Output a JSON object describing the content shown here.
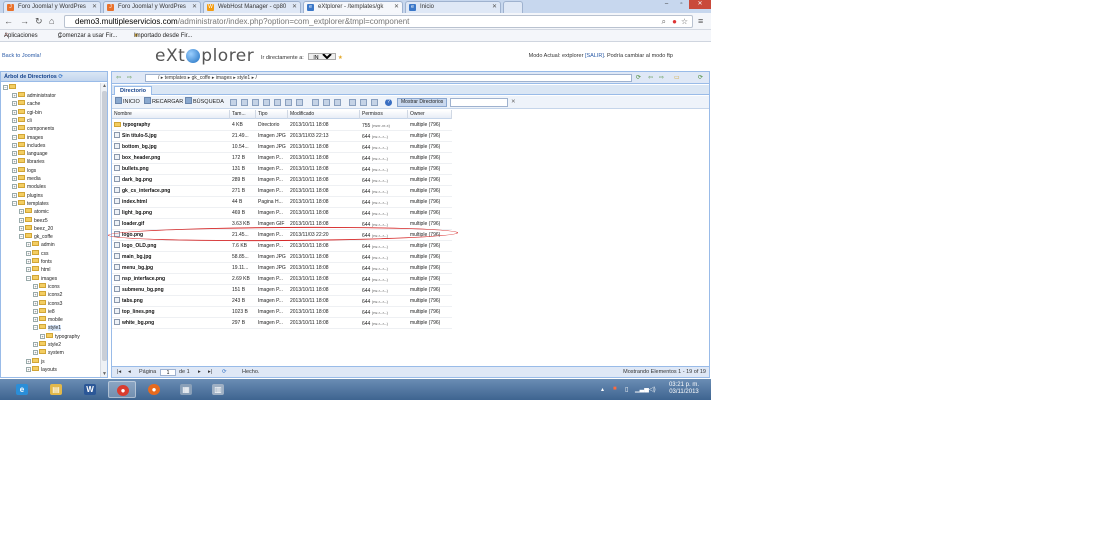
{
  "browser": {
    "tabs": [
      {
        "label": "Foro Joomla! y WordPres",
        "fav": "joomla"
      },
      {
        "label": "Foro Joomla! y WordPres",
        "fav": "joomla"
      },
      {
        "label": "WebHost Manager - cp80",
        "fav": "whm"
      },
      {
        "label": "eXtplorer - /templates/gk",
        "fav": "extplorer"
      },
      {
        "label": "Inicio",
        "fav": "extplorer"
      }
    ],
    "url_host": "demo3.multipleservicios.com",
    "url_path": "/administrator/index.php?option=com_extplorer&tmpl=component",
    "bookmarks": [
      "Aplicaciones",
      "Comenzar a usar Fir...",
      "Importado desde Fir..."
    ]
  },
  "header": {
    "back_link": "Back to Joomla!",
    "logo_left": "eXt",
    "logo_right": "plorer",
    "goto_label": "Ir directamente a:",
    "goto_value": "INICIO",
    "mode_text": "Modo Actual: extplorer",
    "salir": "[SALIR]",
    "mode_hint": "Podría cambiar al modo ftp"
  },
  "tree": {
    "title": "Árbol de Directorios",
    "items": [
      {
        "label": "administrator",
        "level": 1
      },
      {
        "label": "cache",
        "level": 1
      },
      {
        "label": "cgi-bin",
        "level": 1
      },
      {
        "label": "cli",
        "level": 1
      },
      {
        "label": "components",
        "level": 1
      },
      {
        "label": "images",
        "level": 1
      },
      {
        "label": "includes",
        "level": 1
      },
      {
        "label": "language",
        "level": 1
      },
      {
        "label": "libraries",
        "level": 1
      },
      {
        "label": "logs",
        "level": 1
      },
      {
        "label": "media",
        "level": 1
      },
      {
        "label": "modules",
        "level": 1
      },
      {
        "label": "plugins",
        "level": 1
      },
      {
        "label": "templates",
        "level": 1
      },
      {
        "label": "atomic",
        "level": 2
      },
      {
        "label": "beez5",
        "level": 2
      },
      {
        "label": "beez_20",
        "level": 2
      },
      {
        "label": "gk_coffe",
        "level": 2
      },
      {
        "label": "admin",
        "level": 3
      },
      {
        "label": "css",
        "level": 3
      },
      {
        "label": "fonts",
        "level": 3
      },
      {
        "label": "html",
        "level": 3
      },
      {
        "label": "images",
        "level": 3
      },
      {
        "label": "icons",
        "level": 4
      },
      {
        "label": "icons2",
        "level": 4
      },
      {
        "label": "icons3",
        "level": 4
      },
      {
        "label": "ie8",
        "level": 4
      },
      {
        "label": "mobile",
        "level": 4
      },
      {
        "label": "style1",
        "level": 4
      },
      {
        "label": "typography",
        "level": 5
      },
      {
        "label": "style2",
        "level": 4
      },
      {
        "label": "system",
        "level": 4
      },
      {
        "label": "js",
        "level": 3
      },
      {
        "label": "layouts",
        "level": 3
      }
    ]
  },
  "path": {
    "segments": "/ ▸ templates ▸ gk_coffe ▸ images ▸ style1 ▸ /"
  },
  "tab": {
    "label": "Directorio"
  },
  "actions": {
    "home": "INICIO",
    "reload": "RECARGAR",
    "search": "BÚSQUEDA",
    "show_dirs": "Mostrar Directorios",
    "clear": "✕"
  },
  "columns": [
    "Nombre",
    "Tam...",
    "Tipo",
    "Modificado",
    "Permisos",
    "Owner"
  ],
  "files": [
    {
      "name": "typography",
      "size": "4 KB",
      "type": "Directorio",
      "mod": "2013/10/11 18:08",
      "perm": "755",
      "rw": "(rwxr-xr-x)",
      "owner": "multiple (796)",
      "dir": true
    },
    {
      "name": "Sin título-5.jpg",
      "size": "21.49...",
      "type": "Imagen JPG",
      "mod": "2013/11/03 22:13",
      "perm": "644",
      "rw": "(rw-r--r--)",
      "owner": "multiple (796)"
    },
    {
      "name": "bottom_bg.jpg",
      "size": "10.54...",
      "type": "Imagen JPG",
      "mod": "2013/10/11 18:08",
      "perm": "644",
      "rw": "(rw-r--r--)",
      "owner": "multiple (796)"
    },
    {
      "name": "box_header.png",
      "size": "172 B",
      "type": "Imagen P...",
      "mod": "2013/10/11 18:08",
      "perm": "644",
      "rw": "(rw-r--r--)",
      "owner": "multiple (796)"
    },
    {
      "name": "bullets.png",
      "size": "131 B",
      "type": "Imagen P...",
      "mod": "2013/10/11 18:08",
      "perm": "644",
      "rw": "(rw-r--r--)",
      "owner": "multiple (796)"
    },
    {
      "name": "dark_bg.png",
      "size": "289 B",
      "type": "Imagen P...",
      "mod": "2013/10/11 18:08",
      "perm": "644",
      "rw": "(rw-r--r--)",
      "owner": "multiple (796)"
    },
    {
      "name": "gk_cs_interface.png",
      "size": "271 B",
      "type": "Imagen P...",
      "mod": "2013/10/11 18:08",
      "perm": "644",
      "rw": "(rw-r--r--)",
      "owner": "multiple (796)"
    },
    {
      "name": "index.html",
      "size": "44 B",
      "type": "Pagina H...",
      "mod": "2013/10/11 18:08",
      "perm": "644",
      "rw": "(rw-r--r--)",
      "owner": "multiple (796)"
    },
    {
      "name": "light_bg.png",
      "size": "469 B",
      "type": "Imagen P...",
      "mod": "2013/10/11 18:08",
      "perm": "644",
      "rw": "(rw-r--r--)",
      "owner": "multiple (796)"
    },
    {
      "name": "loader.gif",
      "size": "3.63 KB",
      "type": "Imagen GIF",
      "mod": "2013/10/11 18:08",
      "perm": "644",
      "rw": "(rw-r--r--)",
      "owner": "multiple (796)"
    },
    {
      "name": "logo.png",
      "size": "21.45...",
      "type": "Imagen P...",
      "mod": "2013/11/03 22:20",
      "perm": "644",
      "rw": "(rw-r--r--)",
      "owner": "multiple (796)"
    },
    {
      "name": "logo_OLD.png",
      "size": "7.6 KB",
      "type": "Imagen P...",
      "mod": "2013/10/11 18:08",
      "perm": "644",
      "rw": "(rw-r--r--)",
      "owner": "multiple (796)"
    },
    {
      "name": "main_bg.jpg",
      "size": "58.85...",
      "type": "Imagen JPG",
      "mod": "2013/10/11 18:08",
      "perm": "644",
      "rw": "(rw-r--r--)",
      "owner": "multiple (796)"
    },
    {
      "name": "menu_bg.jpg",
      "size": "19.11...",
      "type": "Imagen JPG",
      "mod": "2013/10/11 18:08",
      "perm": "644",
      "rw": "(rw-r--r--)",
      "owner": "multiple (796)"
    },
    {
      "name": "nsp_interface.png",
      "size": "2.69 KB",
      "type": "Imagen P...",
      "mod": "2013/10/11 18:08",
      "perm": "644",
      "rw": "(rw-r--r--)",
      "owner": "multiple (796)"
    },
    {
      "name": "submenu_bg.png",
      "size": "151 B",
      "type": "Imagen P...",
      "mod": "2013/10/11 18:08",
      "perm": "644",
      "rw": "(rw-r--r--)",
      "owner": "multiple (796)"
    },
    {
      "name": "tabs.png",
      "size": "243 B",
      "type": "Imagen P...",
      "mod": "2013/10/11 18:08",
      "perm": "644",
      "rw": "(rw-r--r--)",
      "owner": "multiple (796)"
    },
    {
      "name": "top_lines.png",
      "size": "1023 B",
      "type": "Imagen P...",
      "mod": "2013/10/11 18:08",
      "perm": "644",
      "rw": "(rw-r--r--)",
      "owner": "multiple (796)"
    },
    {
      "name": "white_bg.png",
      "size": "297 B",
      "type": "Imagen P...",
      "mod": "2013/10/11 18:08",
      "perm": "644",
      "rw": "(rw-r--r--)",
      "owner": "multiple (796)"
    }
  ],
  "pager": {
    "page_label": "Página",
    "page_value": "1",
    "of_label": "de 1",
    "done": "Hecho.",
    "showing": "Mostrando Elementos 1 - 19 of 19"
  },
  "taskbar": {
    "time": "03:21 p. m.",
    "date": "03/11/2013"
  },
  "colors": {
    "accent": "#15428b",
    "panel_border": "#99bbe8",
    "highlight_ring": "#d62a2a"
  }
}
